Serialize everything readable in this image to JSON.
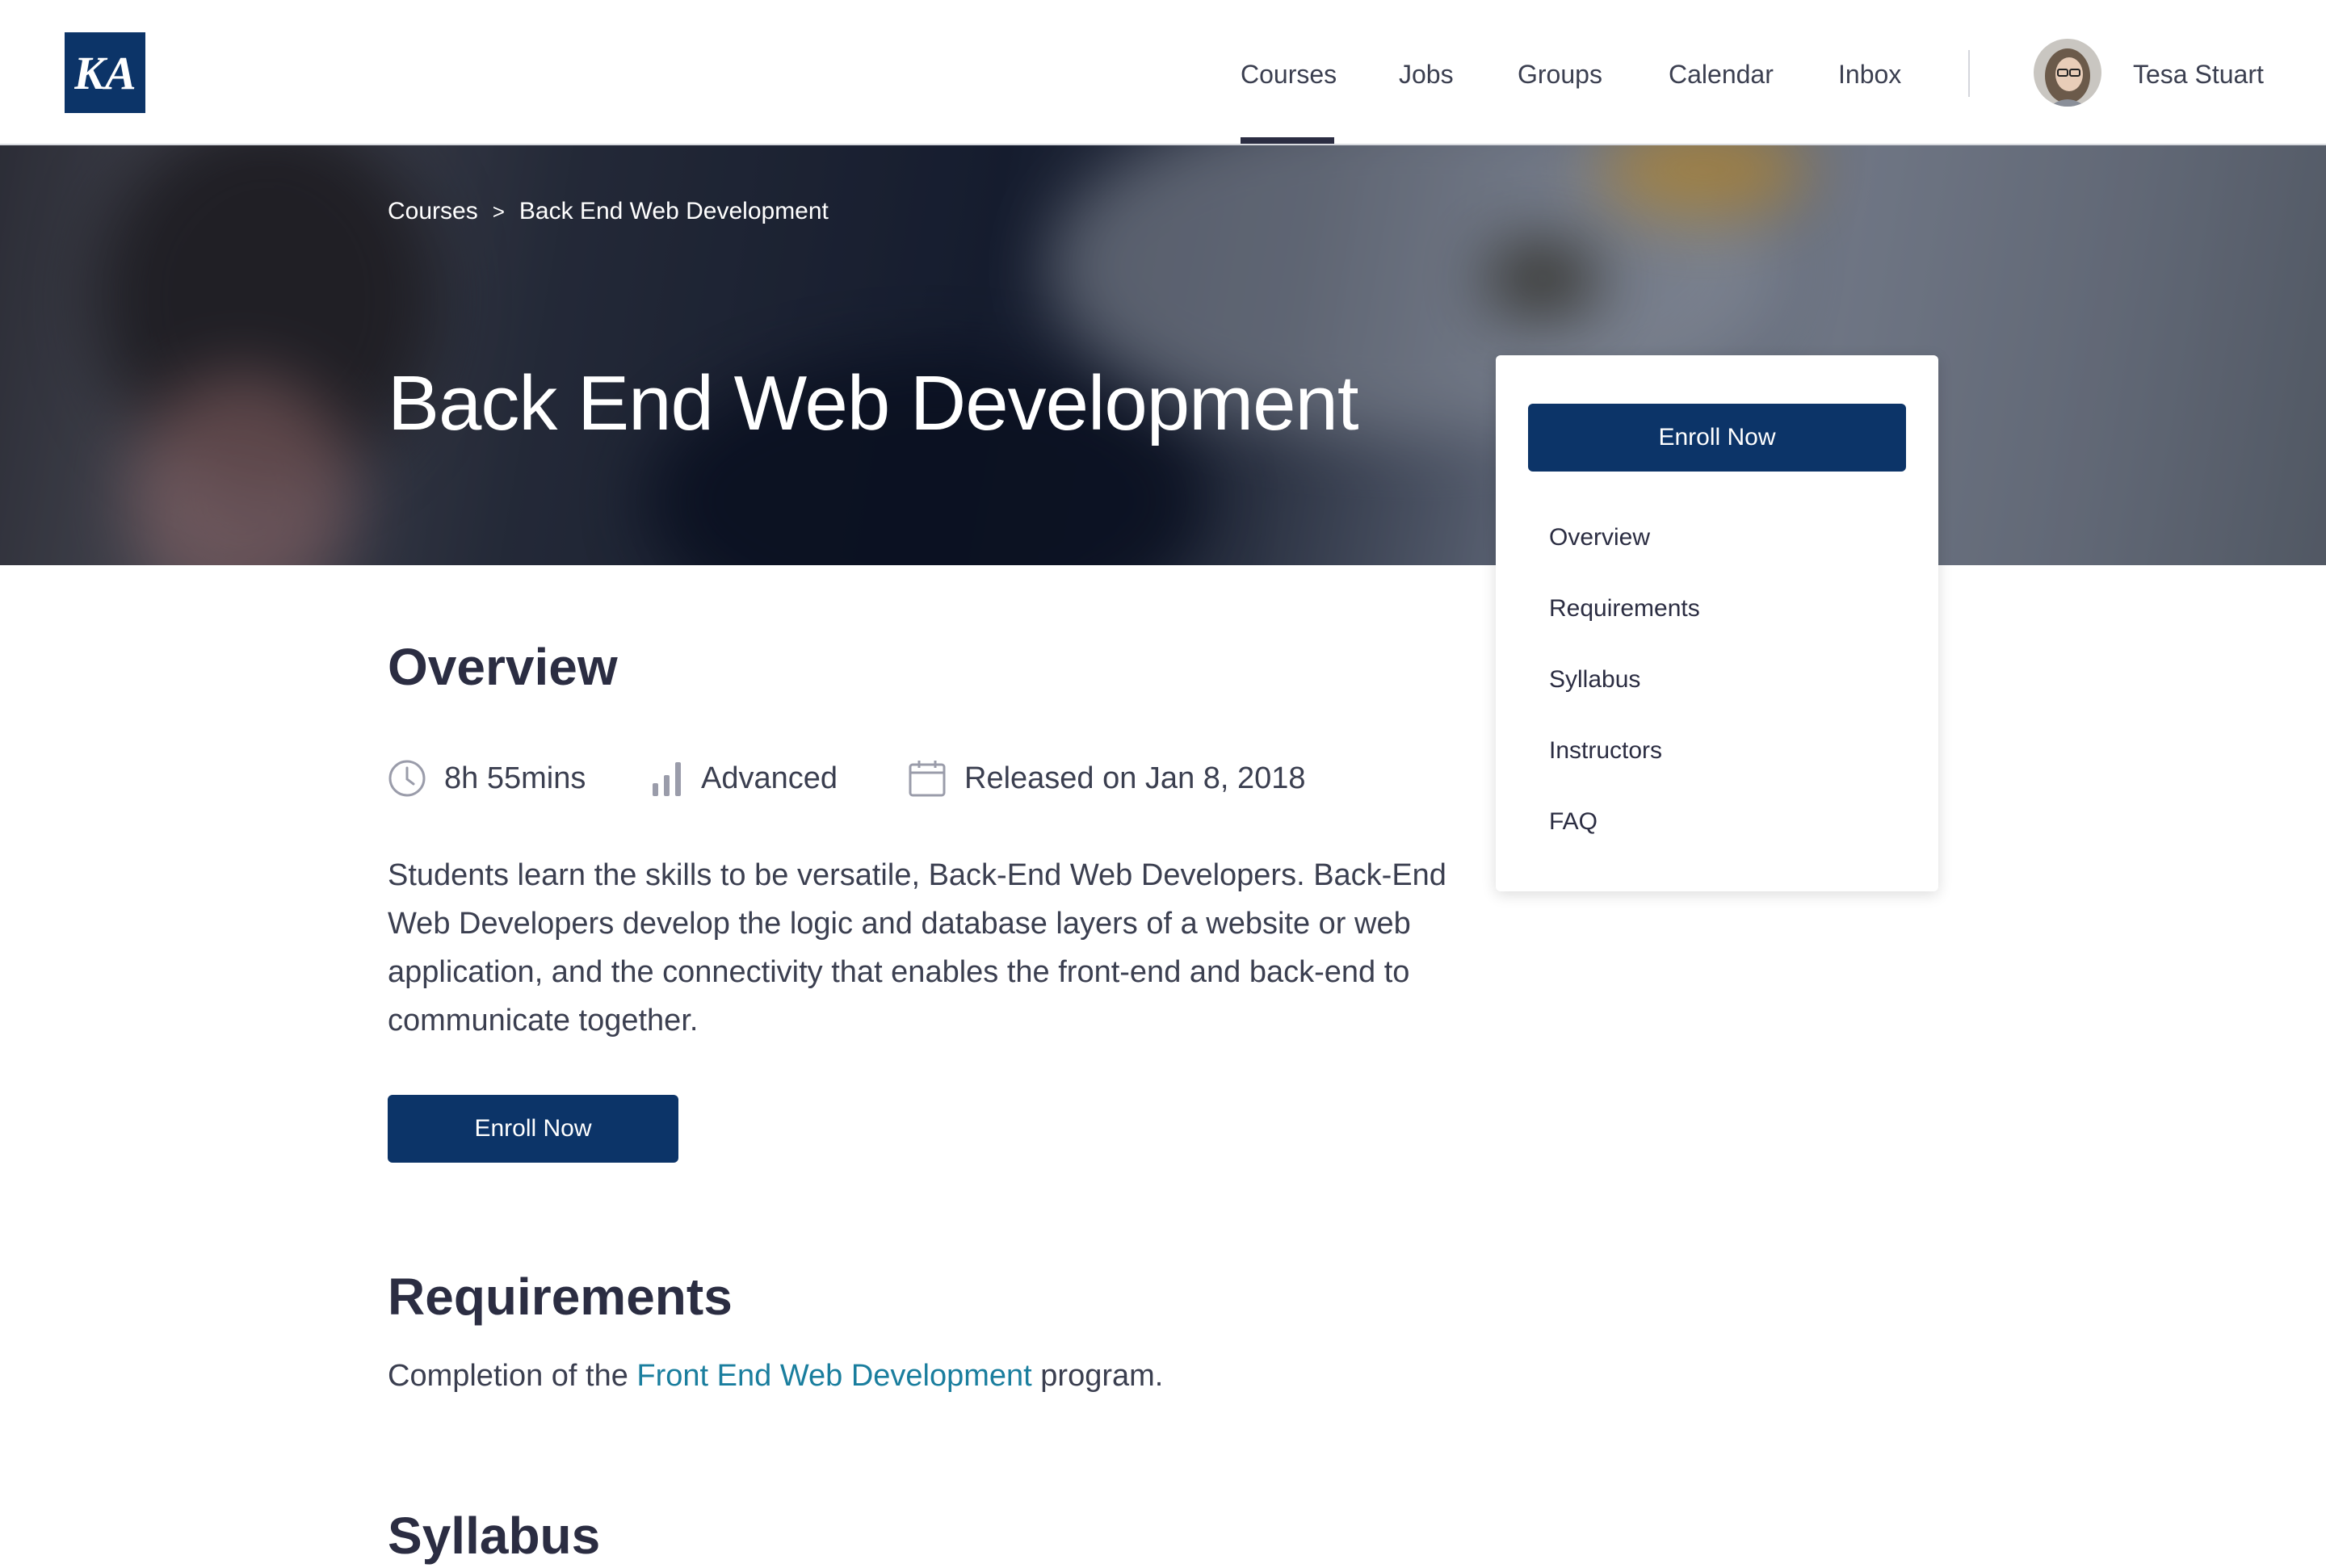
{
  "brand": {
    "logo_text": "KA",
    "accent": "#0c3468",
    "link_color": "#1a7e9e"
  },
  "nav": {
    "items": [
      "Courses",
      "Jobs",
      "Groups",
      "Calendar",
      "Inbox"
    ],
    "active": "Courses",
    "user_name": "Tesa Stuart"
  },
  "breadcrumb": {
    "root": "Courses",
    "separator": ">",
    "current": "Back End Web Development"
  },
  "hero": {
    "title": "Back End Web Development"
  },
  "side_card": {
    "enroll_label": "Enroll Now",
    "links": [
      "Overview",
      "Requirements",
      "Syllabus",
      "Instructors",
      "FAQ"
    ]
  },
  "overview": {
    "heading": "Overview",
    "duration": "8h 55mins",
    "level": "Advanced",
    "released": "Released on Jan 8, 2018",
    "description": "Students learn the skills to be versatile, Back-End Web Developers. Back-End Web Developers develop the logic and database layers of a website or web application, and the connectivity that enables the front-end and back-end to communicate together.",
    "enroll_label": "Enroll Now"
  },
  "requirements": {
    "heading": "Requirements",
    "text_before": "Completion of the ",
    "link_text": "Front End Web Development",
    "text_after": " program."
  },
  "syllabus": {
    "heading": "Syllabus"
  },
  "icons": {
    "logo": "ka-logo-icon",
    "duration": "clock-icon",
    "level": "bar-chart-icon",
    "released": "calendar-icon",
    "breadcrumb_separator": "chevron-right-icon"
  }
}
